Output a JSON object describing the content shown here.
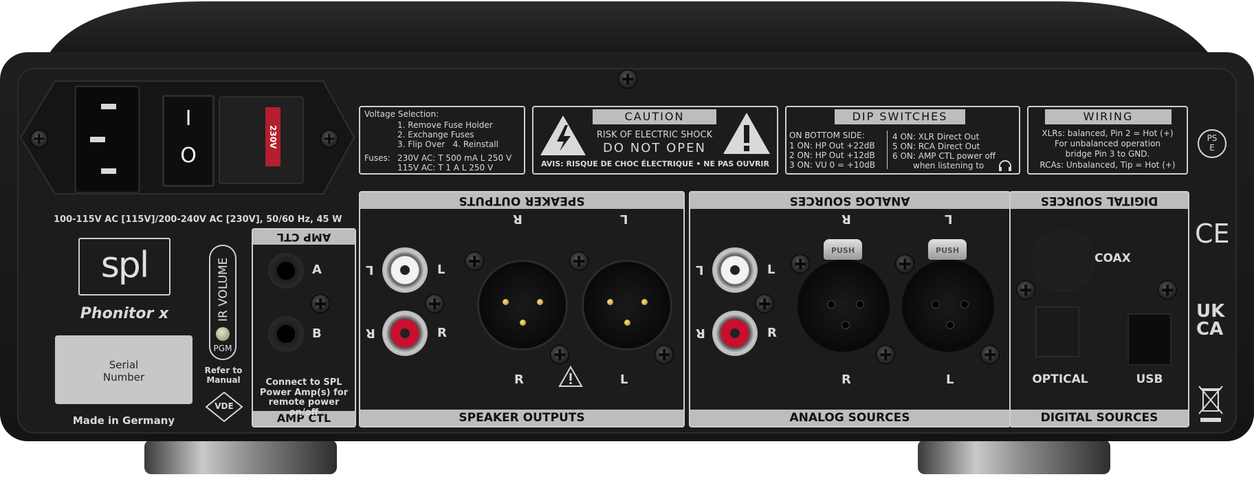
{
  "power": {
    "spec": "100-115V AC [115V]/200-240V AC [230V], 50/60 Hz, 45 W",
    "fuse_badge": "230V",
    "switch_on": "I",
    "switch_off": "O"
  },
  "voltage_box": {
    "title": "Voltage Selection:",
    "steps": [
      "1. Remove Fuse Holder",
      "2. Exchange Fuses",
      "3. Flip Over   4. Reinstall"
    ],
    "fuses_label": "Fuses:",
    "fuse_230": "230V AC: T 500 mA L 250 V",
    "fuse_115": "115V AC: T 1 A L 250 V"
  },
  "caution_box": {
    "title": "CAUTION",
    "line1": "RISK OF ELECTRIC SHOCK",
    "line2": "DO NOT OPEN",
    "line3": "AVIS: RISQUE DE CHOC ÉLECTRIQUE • NE PAS OUVRIR"
  },
  "dip_box": {
    "title": "DIP SWITCHES",
    "left": [
      "ON BOTTOM SIDE:",
      "1 ON: HP Out +22dB",
      "2 ON: HP Out +12dB",
      "3 ON: VU 0 = +10dB"
    ],
    "right": [
      "4 ON: XLR Direct Out",
      "5 ON: RCA Direct Out",
      "6 ON: AMP CTL power off",
      "when listening to"
    ]
  },
  "wiring_box": {
    "title": "WIRING",
    "lines": [
      "XLRs: balanced, Pin 2 = Hot (+)",
      "For unbalanced operation",
      "bridge Pin 3 to GND.",
      "RCAs: Unbalanced, Tip = Hot (+)"
    ]
  },
  "marks": {
    "pse": "PS\nE",
    "pse_a": "PS",
    "pse_b": "E",
    "ce": "CE",
    "ukca_top": "UK",
    "ukca_bottom": "CA",
    "vde": "VDE"
  },
  "brand": {
    "logo": "spl",
    "model": "Phonitor x",
    "serial": "Serial Number",
    "serial_a": "Serial",
    "serial_b": "Number",
    "made_in": "Made in Germany"
  },
  "volume_block": {
    "label": "IR VOLUME",
    "ir": "IR",
    "pgm": "PGM",
    "refer_a": "Refer to",
    "refer_b": "Manual"
  },
  "amp_ctl": {
    "title_top": "AMP CTL",
    "title_bottom": "AMP CTL",
    "a": "A",
    "b": "B",
    "note": [
      "Connect to SPL",
      "Power Amp(s) for",
      "remote power on/off"
    ]
  },
  "speaker_outputs": {
    "title_top": "SPEAKER OUTPUTS",
    "title_bottom": "SPEAKER OUTPUTS",
    "top_r": "R",
    "top_l": "L",
    "rca_l_left": "L",
    "rca_l_right": "L",
    "rca_r_left": "R",
    "rca_r_right": "R",
    "bottom_r": "R",
    "bottom_l": "L"
  },
  "analog_sources": {
    "title_top": "ANALOG SOURCES",
    "title_bottom": "ANALOG SOURCES",
    "top_r": "R",
    "top_l": "L",
    "rca_l_left": "L",
    "rca_l_right": "L",
    "rca_r_left": "R",
    "rca_r_right": "R",
    "push": "PUSH",
    "bottom_r": "R",
    "bottom_l": "L"
  },
  "digital_sources": {
    "title_top": "DIGITAL SOURCES",
    "title_bottom": "DIGITAL SOURCES",
    "coax": "COAX",
    "optical": "OPTICAL",
    "usb": "USB"
  },
  "colors": {
    "chassis": "#1b1b1b",
    "top": "#2a2a2a",
    "label_grey": "#bdbdbd",
    "rca_red": "#c8102e",
    "rca_white": "#f2f2f2",
    "fuse_red": "#b3202c"
  }
}
